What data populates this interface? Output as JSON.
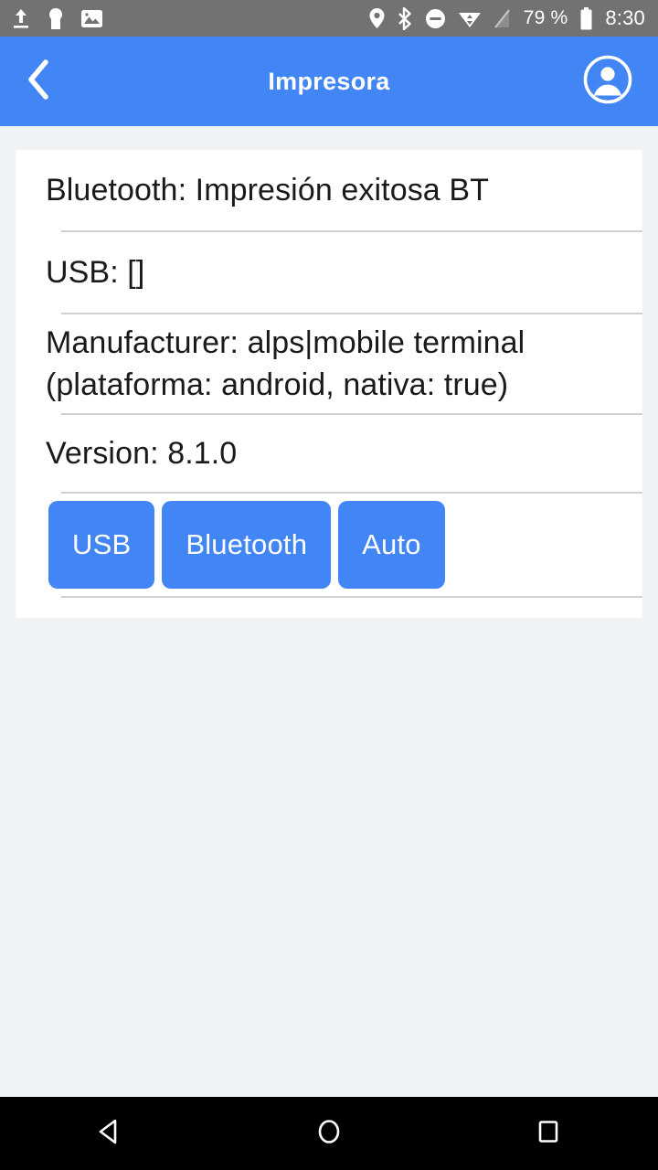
{
  "statusbar": {
    "left_icons": [
      "upload-icon",
      "usb-debug-icon",
      "image-icon"
    ],
    "right_icons": [
      "location-icon",
      "bluetooth-icon",
      "do-not-disturb-icon",
      "wifi-icon",
      "no-signal-icon"
    ],
    "battery_percent": "79 %",
    "battery_icon": "battery-icon",
    "clock": "8:30",
    "background": "#727272"
  },
  "appbar": {
    "title": "Impresora",
    "back_icon": "chevron-left-icon",
    "account_icon": "account-circle-icon",
    "background": "#4285f4"
  },
  "card": {
    "rows": [
      {
        "text": "Bluetooth: Impresión exitosa BT"
      },
      {
        "text": "USB: []"
      },
      {
        "text": "Manufacturer: alps|mobile terminal (plataforma: android, nativa: true)"
      },
      {
        "text": "Version: 8.1.0"
      }
    ],
    "buttons": [
      {
        "label": "USB"
      },
      {
        "label": "Bluetooth"
      },
      {
        "label": "Auto"
      }
    ],
    "button_color": "#4285f4",
    "background": "#ffffff",
    "separator_color": "#d0d0d0"
  },
  "navbar": {
    "back": "nav-back-icon",
    "home": "nav-home-icon",
    "recents": "nav-recents-icon",
    "background": "#000000"
  },
  "page": {
    "background": "#eff3f6"
  }
}
